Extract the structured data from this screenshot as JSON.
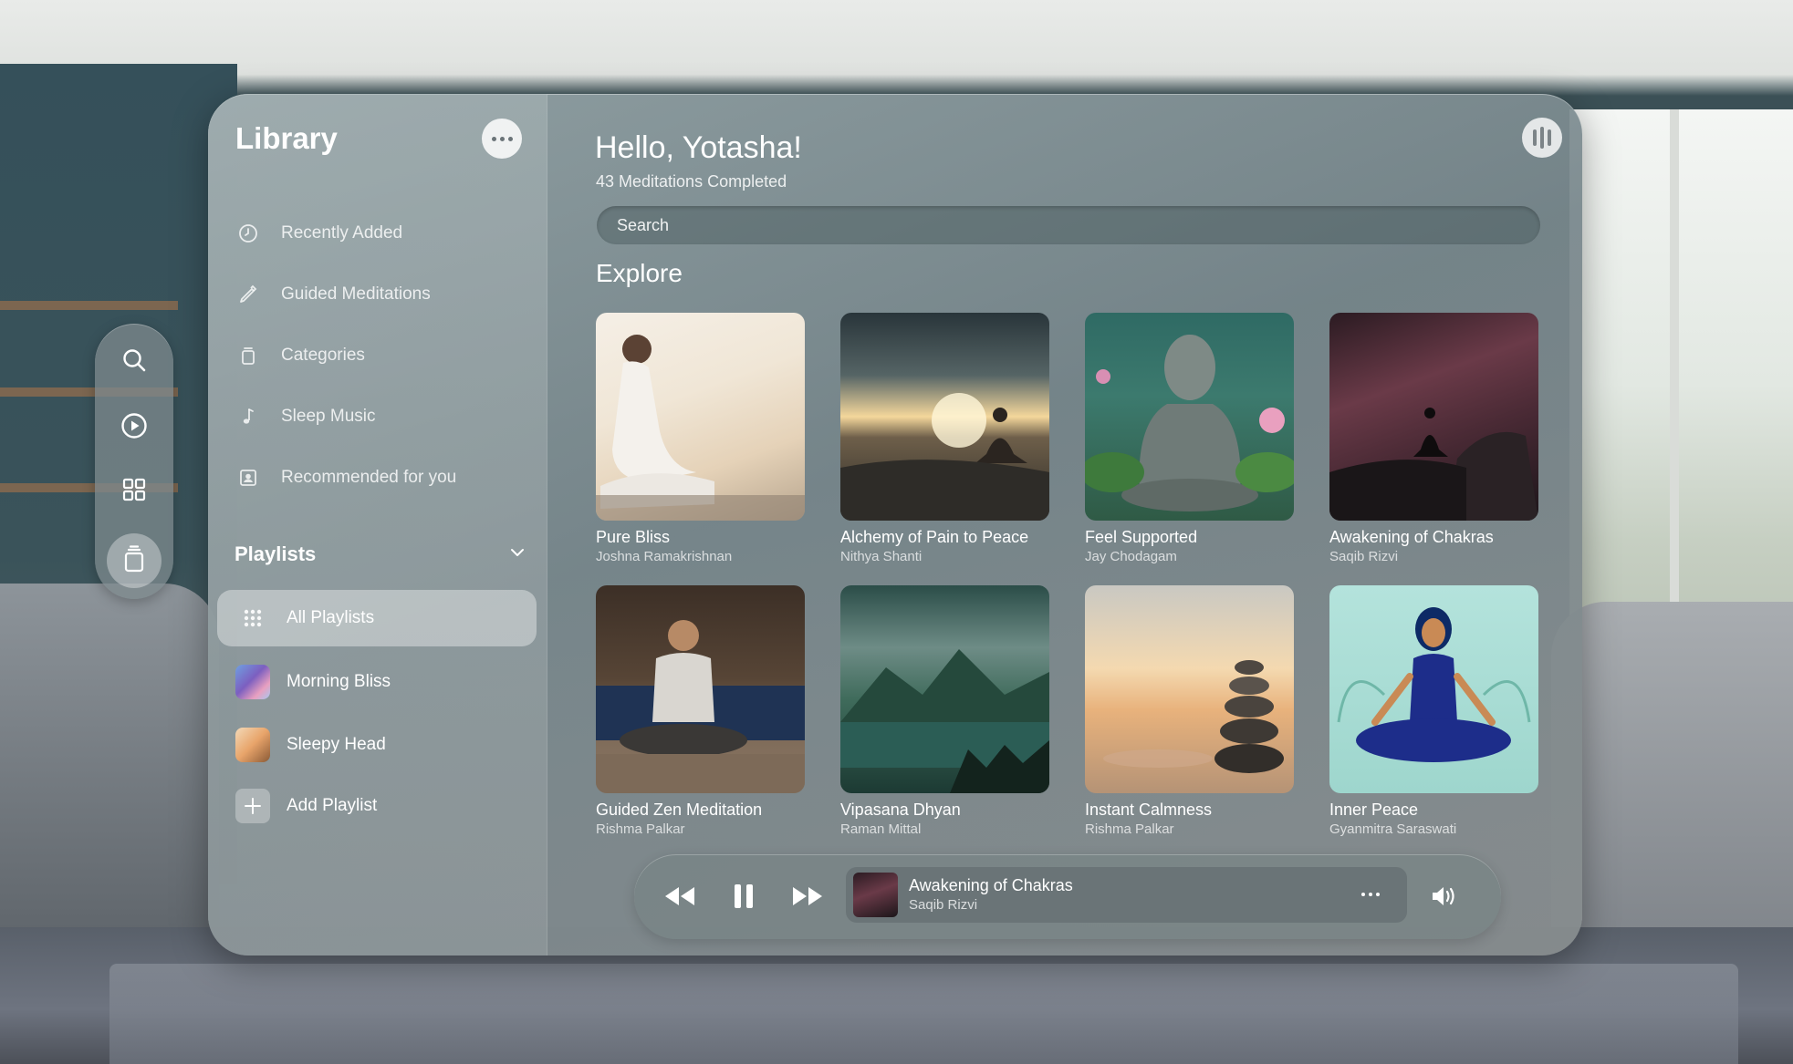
{
  "library": {
    "title": "Library",
    "nav": [
      {
        "label": "Recently Added",
        "icon": "clock-icon"
      },
      {
        "label": "Guided Meditations",
        "icon": "pencil-icon"
      },
      {
        "label": "Categories",
        "icon": "stack-icon"
      },
      {
        "label": "Sleep Music",
        "icon": "music-note-icon"
      },
      {
        "label": "Recommended for you",
        "icon": "person-square-icon"
      }
    ],
    "playlists_title": "Playlists",
    "playlists": [
      {
        "label": "All Playlists",
        "icon": "grid-dots-icon",
        "active": true
      },
      {
        "label": "Morning Bliss",
        "icon": "playlist-thumb"
      },
      {
        "label": "Sleepy Head",
        "icon": "playlist-thumb"
      },
      {
        "label": "Add Playlist",
        "icon": "plus-icon"
      }
    ]
  },
  "header": {
    "greeting": "Hello, Yotasha!",
    "subtitle": "43 Meditations Completed"
  },
  "search": {
    "placeholder": "Search"
  },
  "explore": {
    "title": "Explore",
    "cards": [
      {
        "title": "Pure Bliss",
        "author": "Joshna Ramakrishnan"
      },
      {
        "title": "Alchemy of Pain to Peace",
        "author": "Nithya Shanti"
      },
      {
        "title": "Feel Supported",
        "author": "Jay Chodagam"
      },
      {
        "title": "Awakening of Chakras",
        "author": "Saqib Rizvi"
      },
      {
        "title": "Guided Zen Meditation",
        "author": "Rishma Palkar"
      },
      {
        "title": "Vipasana Dhyan",
        "author": "Raman Mittal"
      },
      {
        "title": "Instant Calmness",
        "author": "Rishma Palkar"
      },
      {
        "title": "Inner Peace",
        "author": "Gyanmitra Saraswati"
      }
    ]
  },
  "player": {
    "title": "Awakening of Chakras",
    "artist": "Saqib Rizvi"
  },
  "ornament": [
    "search-icon",
    "play-icon",
    "grid-icon",
    "library-icon"
  ]
}
